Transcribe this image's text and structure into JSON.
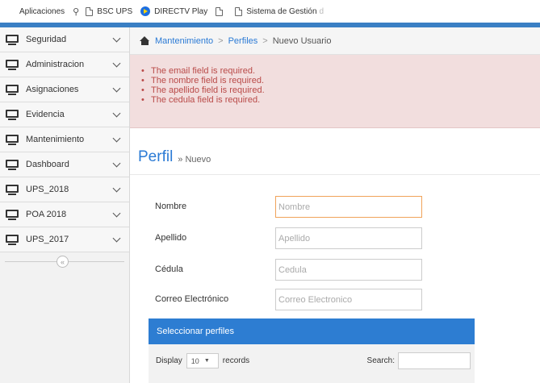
{
  "bookmarks": {
    "apps": "Aplicaciones",
    "items": [
      "BSC UPS",
      "DIRECTV Play",
      "",
      "Sistema de Gestión"
    ],
    "overflow": "d"
  },
  "sidebar": {
    "items": [
      {
        "label": "Seguridad"
      },
      {
        "label": "Administracion"
      },
      {
        "label": "Asignaciones"
      },
      {
        "label": "Evidencia"
      },
      {
        "label": "Mantenimiento"
      },
      {
        "label": "Dashboard"
      },
      {
        "label": "UPS_2018"
      },
      {
        "label": "POA 2018"
      },
      {
        "label": "UPS_2017"
      }
    ],
    "collapse_glyph": "«"
  },
  "breadcrumb": {
    "home": "Mantenimiento",
    "section": "Perfiles",
    "current": "Nuevo Usuario",
    "separator": ">"
  },
  "alert": {
    "messages": [
      "The email field is required.",
      "The nombre field is required.",
      "The apellido field is required.",
      "The cedula field is required."
    ]
  },
  "page": {
    "title": "Perfil",
    "subtitle": "» Nuevo"
  },
  "form": {
    "fields": [
      {
        "label": "Nombre",
        "placeholder": "Nombre",
        "value": ""
      },
      {
        "label": "Apellido",
        "placeholder": "Apellido",
        "value": ""
      },
      {
        "label": "Cédula",
        "placeholder": "Cedula",
        "value": ""
      },
      {
        "label": "Correo Electrónico",
        "placeholder": "Correo Electronico",
        "value": ""
      }
    ]
  },
  "profiles_panel": {
    "title": "Seleccionar perfiles",
    "display_label": "Display",
    "length_value": "10",
    "records_label": "records",
    "search_label": "Search:"
  },
  "colors": {
    "accent": "#2d7dd2",
    "alert_bg": "#f2dede",
    "alert_text": "#b94a48",
    "focus_border": "#f0a35a"
  }
}
